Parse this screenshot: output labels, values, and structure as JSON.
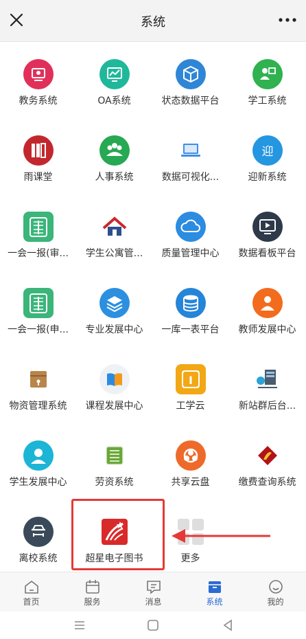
{
  "header": {
    "title": "系统"
  },
  "apps": [
    {
      "label": "教务系统",
      "icon": "teaching-icon",
      "color": "#e0305a"
    },
    {
      "label": "OA系统",
      "icon": "chart-screen-icon",
      "color": "#1fb89b"
    },
    {
      "label": "状态数据平台",
      "icon": "cube-icon",
      "color": "#2f86d6"
    },
    {
      "label": "学工系统",
      "icon": "user-board-icon",
      "color": "#2fb24f"
    },
    {
      "label": "雨课堂",
      "icon": "rain-class-icon",
      "color": "#c3272e"
    },
    {
      "label": "人事系统",
      "icon": "people-icon",
      "color": "#27a852"
    },
    {
      "label": "数据可视化...",
      "icon": "laptop-icon",
      "color": "#ffffff"
    },
    {
      "label": "迎新系统",
      "icon": "welcome-icon",
      "color": "#2596e0"
    },
    {
      "label": "一会一报(审...",
      "icon": "report-icon",
      "color": "#3bb57a"
    },
    {
      "label": "学生公寓管...",
      "icon": "apartment-icon",
      "color": "#ffffff"
    },
    {
      "label": "质量管理中心",
      "icon": "cloud-icon",
      "color": "#2b8ce0"
    },
    {
      "label": "数据看板平台",
      "icon": "monitor-icon",
      "color": "#2e3a4a"
    },
    {
      "label": "一会一报(申...",
      "icon": "report-icon",
      "color": "#3bb57a"
    },
    {
      "label": "专业发展中心",
      "icon": "layers-icon",
      "color": "#2c8fe0"
    },
    {
      "label": "一库一表平台",
      "icon": "database-icon",
      "color": "#2585d8"
    },
    {
      "label": "教师发展中心",
      "icon": "person-icon",
      "color": "#f36b1c"
    },
    {
      "label": "物资管理系统",
      "icon": "box-icon",
      "color": "#c99856"
    },
    {
      "label": "课程发展中心",
      "icon": "book-icon",
      "color": "#eef2f7"
    },
    {
      "label": "工学云",
      "icon": "gongxueyun-icon",
      "color": "#f2a715"
    },
    {
      "label": "新站群后台...",
      "icon": "server-icon",
      "color": "#ffffff"
    },
    {
      "label": "学生发展中心",
      "icon": "student-icon",
      "color": "#1cb5d6"
    },
    {
      "label": "劳资系统",
      "icon": "list-icon",
      "color": "#4a8b2a"
    },
    {
      "label": "共享云盘",
      "icon": "cloud-disk-icon",
      "color": "#ee6a2a"
    },
    {
      "label": "缴费查询系统",
      "icon": "payment-icon",
      "color": "#c81e22"
    },
    {
      "label": "离校系统",
      "icon": "leave-icon",
      "color": "#3a4a5a"
    },
    {
      "label": "超星电子图书",
      "icon": "chaoxing-icon",
      "color": "#d92a2a"
    },
    {
      "label": "更多",
      "icon": "more-grid-icon",
      "color": "#e0e0e0"
    }
  ],
  "tabs": [
    {
      "label": "首页",
      "icon": "home-icon"
    },
    {
      "label": "服务",
      "icon": "calendar-icon"
    },
    {
      "label": "消息",
      "icon": "message-icon"
    },
    {
      "label": "系统",
      "icon": "system-icon",
      "active": true
    },
    {
      "label": "我的",
      "icon": "profile-icon"
    }
  ],
  "accent_color": "#2a6ad3",
  "highlight_color": "#e53935"
}
